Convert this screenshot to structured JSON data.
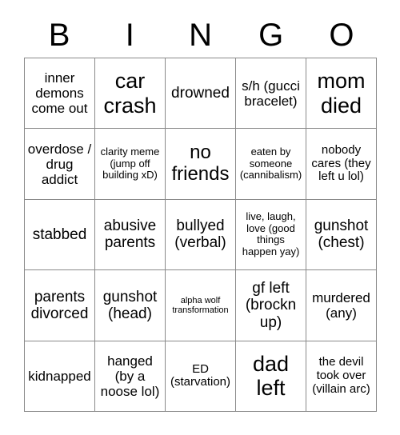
{
  "header": {
    "letters": [
      "B",
      "I",
      "N",
      "G",
      "O"
    ]
  },
  "grid": {
    "columns": 5,
    "rows": 5,
    "border_color": "#8a8a8a",
    "background_color": "#ffffff",
    "text_color": "#000000",
    "cells": [
      {
        "text": "inner demons come out",
        "size": "md"
      },
      {
        "text": "car crash",
        "size": "xxl"
      },
      {
        "text": "drowned",
        "size": "lg"
      },
      {
        "text": "s/h (gucci bracelet)",
        "size": "md"
      },
      {
        "text": "mom died",
        "size": "xxl"
      },
      {
        "text": "overdose / drug addict",
        "size": "md"
      },
      {
        "text": "clarity meme (jump off building xD)",
        "size": "xs"
      },
      {
        "text": "no friends",
        "size": "xl"
      },
      {
        "text": "eaten by someone (cannibalism)",
        "size": "xs"
      },
      {
        "text": "nobody cares (they left u lol)",
        "size": "sm"
      },
      {
        "text": "stabbed",
        "size": "lg"
      },
      {
        "text": "abusive parents",
        "size": "lg"
      },
      {
        "text": "bullyed (verbal)",
        "size": "lg"
      },
      {
        "text": "live, laugh, love (good things happen yay)",
        "size": "xs"
      },
      {
        "text": "gunshot (chest)",
        "size": "lg"
      },
      {
        "text": "parents divorced",
        "size": "lg"
      },
      {
        "text": "gunshot (head)",
        "size": "lg"
      },
      {
        "text": "alpha wolf transformation",
        "size": "xxs"
      },
      {
        "text": "gf left (brockn up)",
        "size": "lg"
      },
      {
        "text": "murdered (any)",
        "size": "md"
      },
      {
        "text": "kidnapped",
        "size": "md"
      },
      {
        "text": "hanged (by a noose lol)",
        "size": "md"
      },
      {
        "text": "ED (starvation)",
        "size": "sm"
      },
      {
        "text": "dad left",
        "size": "xxl"
      },
      {
        "text": "the devil took over (villain arc)",
        "size": "sm"
      }
    ]
  }
}
